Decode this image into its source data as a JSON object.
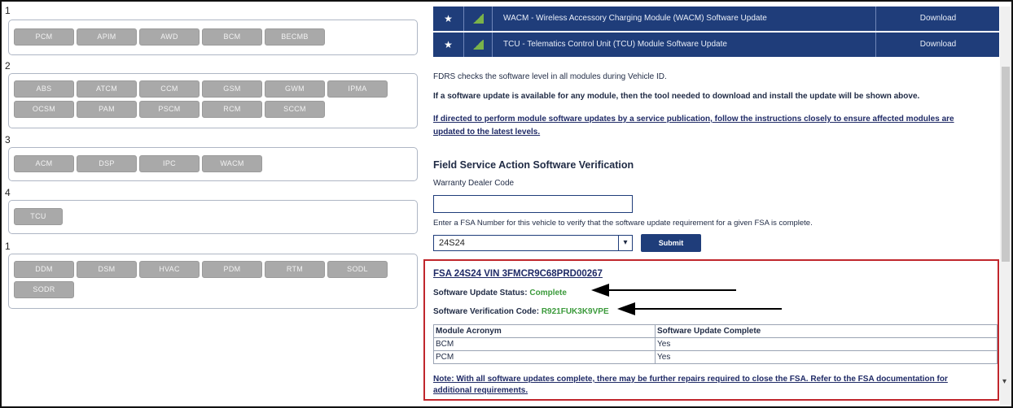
{
  "groups": [
    {
      "label": "1",
      "modules": [
        "PCM",
        "APIM",
        "AWD",
        "BCM",
        "BECMB"
      ]
    },
    {
      "label": "2",
      "modules": [
        "ABS",
        "ATCM",
        "CCM",
        "GSM",
        "GWM",
        "IPMA",
        "OCSM",
        "PAM",
        "PSCM",
        "RCM",
        "SCCM"
      ]
    },
    {
      "label": "3",
      "modules": [
        "ACM",
        "DSP",
        "IPC",
        "WACM"
      ]
    },
    {
      "label": "4",
      "modules": [
        "TCU"
      ]
    },
    {
      "label": "1",
      "modules": [
        "DDM",
        "DSM",
        "HVAC",
        "PDM",
        "RTM",
        "SODL",
        "SODR"
      ]
    }
  ],
  "downloads": [
    {
      "star": "★",
      "name": "WACM - Wireless Accessory Charging Module (WACM) Software Update",
      "action": "Download"
    },
    {
      "star": "★",
      "name": "TCU - Telematics Control Unit (TCU) Module Software Update",
      "action": "Download"
    }
  ],
  "info": {
    "line1": "FDRS checks the software level in all modules during Vehicle ID.",
    "line2": "If a software update is available for any module, then the tool needed to download and install the update will be shown above.",
    "line3a": "If directed to perform module software updates by a service publication, follow the instructions closely to ensure affected modules are",
    "line3b": "updated to the latest levels."
  },
  "fsa": {
    "heading": "Field Service Action Software Verification",
    "dealer_label": "Warranty Dealer Code",
    "dealer_value": "",
    "prompt": "Enter a FSA Number for this vehicle to verify that the software update requirement for a given FSA is complete.",
    "select_value": "24S24",
    "select_arrow": "▾",
    "submit_label": "Submit"
  },
  "result": {
    "title": "FSA 24S24 VIN 3FMCR9C68PRD00267",
    "status_label": "Software Update Status:",
    "status_value": "Complete",
    "code_label": "Software Verification Code:",
    "code_value": "R921FUK3K9VPE",
    "table": {
      "headers": [
        "Module Acronym",
        "Software Update Complete"
      ],
      "rows": [
        [
          "BCM",
          "Yes"
        ],
        [
          "PCM",
          "Yes"
        ]
      ]
    },
    "note_a": "Note: With all software updates complete, there may be further repairs required to close the FSA. Refer to the FSA documentation for",
    "note_b": "additional requirements."
  },
  "scrollbar": {
    "down_arrow": "▾"
  },
  "colors": {
    "nav_blue": "#1f3d7a",
    "status_green": "#3b9a3b",
    "highlight_red": "#c0262c",
    "module_gray": "#a9a9a9"
  }
}
